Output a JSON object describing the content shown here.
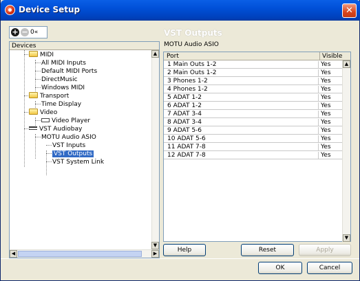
{
  "window": {
    "title": "Device Setup",
    "close_glyph": "✕"
  },
  "toolbar": {
    "add_glyph": "+",
    "remove_glyph": "−",
    "reset_label": "0«"
  },
  "devices": {
    "header": "Devices",
    "items": [
      {
        "label": "MIDI",
        "folder": true
      },
      {
        "label": "All MIDI Inputs"
      },
      {
        "label": "Default MIDI Ports"
      },
      {
        "label": "DirectMusic"
      },
      {
        "label": "Windows MIDI"
      },
      {
        "label": "Transport",
        "folder": true
      },
      {
        "label": "Time Display"
      },
      {
        "label": "Video",
        "folder": true
      },
      {
        "label": "Video Player"
      },
      {
        "label": "VST Audiobay"
      },
      {
        "label": "MOTU Audio ASIO"
      },
      {
        "label": "VST Inputs"
      },
      {
        "label": "VST Outputs",
        "selected": true
      },
      {
        "label": "VST System Link"
      }
    ]
  },
  "main": {
    "section_title": "VST Outputs",
    "driver_name": "MOTU Audio ASIO",
    "columns": {
      "port": "Port",
      "visible": "Visible"
    },
    "rows": [
      {
        "port": "1 Main Outs 1-2",
        "visible": "Yes"
      },
      {
        "port": "2 Main Outs 1-2",
        "visible": "Yes"
      },
      {
        "port": "3 Phones 1-2",
        "visible": "Yes"
      },
      {
        "port": "4 Phones 1-2",
        "visible": "Yes"
      },
      {
        "port": "5 ADAT 1-2",
        "visible": "Yes"
      },
      {
        "port": "6 ADAT 1-2",
        "visible": "Yes"
      },
      {
        "port": "7 ADAT 3-4",
        "visible": "Yes"
      },
      {
        "port": "8 ADAT 3-4",
        "visible": "Yes"
      },
      {
        "port": "9 ADAT 5-6",
        "visible": "Yes"
      },
      {
        "port": "10 ADAT 5-6",
        "visible": "Yes"
      },
      {
        "port": "11 ADAT 7-8",
        "visible": "Yes"
      },
      {
        "port": "12 ADAT 7-8",
        "visible": "Yes"
      }
    ],
    "help_label": "Help",
    "reset_label": "Reset",
    "apply_label": "Apply"
  },
  "footer": {
    "ok_label": "OK",
    "cancel_label": "Cancel"
  },
  "scroll": {
    "up": "▲",
    "down": "▼",
    "left": "◀",
    "right": "▶"
  }
}
